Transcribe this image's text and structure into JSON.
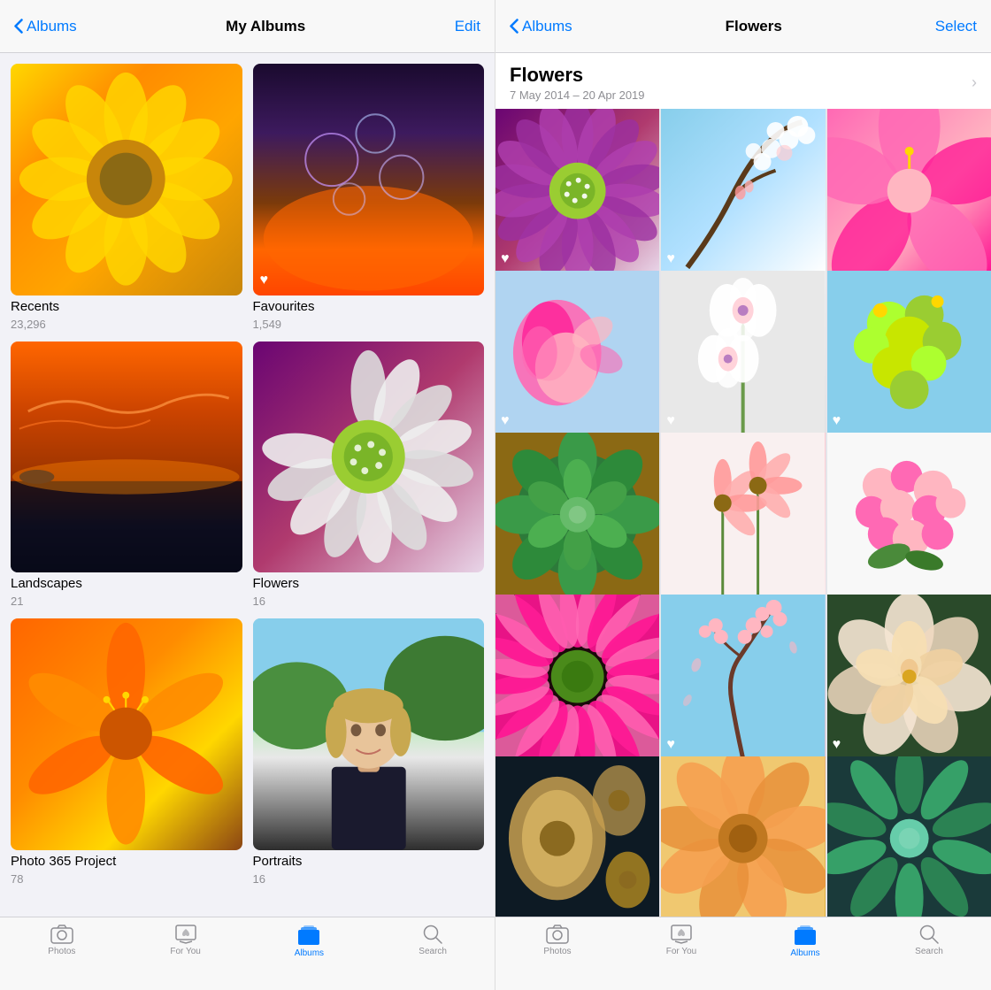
{
  "left": {
    "nav": {
      "back_label": "Albums",
      "title": "My Albums",
      "action_label": "Edit"
    },
    "albums": [
      {
        "id": "recents",
        "name": "Recents",
        "count": "23,296",
        "has_heart": false,
        "color": "recents"
      },
      {
        "id": "favourites",
        "name": "Favourites",
        "count": "1,549",
        "has_heart": true,
        "color": "favourites"
      },
      {
        "id": "landscapes",
        "name": "Landscapes",
        "count": "21",
        "has_heart": false,
        "color": "landscapes"
      },
      {
        "id": "flowers",
        "name": "Flowers",
        "count": "16",
        "has_heart": false,
        "color": "flowers"
      },
      {
        "id": "photo365",
        "name": "Photo 365 Project",
        "count": "78",
        "has_heart": false,
        "color": "photo365"
      },
      {
        "id": "portraits",
        "name": "Portraits",
        "count": "16",
        "has_heart": false,
        "color": "portraits"
      }
    ],
    "tab_bar": {
      "items": [
        {
          "id": "photos",
          "label": "Photos",
          "icon": "📷",
          "active": false
        },
        {
          "id": "for-you",
          "label": "For You",
          "icon": "❤️",
          "active": false
        },
        {
          "id": "albums",
          "label": "Albums",
          "icon": "🗂",
          "active": true
        },
        {
          "id": "search",
          "label": "Search",
          "icon": "🔍",
          "active": false
        }
      ]
    }
  },
  "right": {
    "nav": {
      "back_label": "Albums",
      "title": "Flowers",
      "action_label": "Select"
    },
    "header": {
      "title": "Flowers",
      "date_range": "7 May 2014 – 20 Apr 2019"
    },
    "photos": [
      {
        "id": "p1",
        "color_class": "photo-purple-flower",
        "has_heart": true
      },
      {
        "id": "p2",
        "color_class": "photo-white-blossom",
        "has_heart": true
      },
      {
        "id": "p3",
        "color_class": "photo-pink-flower",
        "has_heart": false
      },
      {
        "id": "p4",
        "color_class": "photo-pink-side",
        "has_heart": true
      },
      {
        "id": "p5",
        "color_class": "photo-white-orchid",
        "has_heart": true
      },
      {
        "id": "p6",
        "color_class": "photo-yellow-green",
        "has_heart": true
      },
      {
        "id": "p7",
        "color_class": "photo-succulent",
        "has_heart": false
      },
      {
        "id": "p8",
        "color_class": "photo-pink-daisy",
        "has_heart": false
      },
      {
        "id": "p9",
        "color_class": "photo-pink-cluster",
        "has_heart": false
      },
      {
        "id": "p10",
        "color_class": "photo-pink-gerbera",
        "has_heart": false
      },
      {
        "id": "p11",
        "color_class": "photo-cherry-blossom",
        "has_heart": true
      },
      {
        "id": "p12",
        "color_class": "photo-cream-rose",
        "has_heart": true
      },
      {
        "id": "p13",
        "color_class": "photo-dark-flower",
        "has_heart": false
      },
      {
        "id": "p14",
        "color_class": "photo-peach-flower",
        "has_heart": false
      },
      {
        "id": "p15",
        "color_class": "photo-teal-leaves",
        "has_heart": false
      }
    ],
    "tab_bar": {
      "items": [
        {
          "id": "photos",
          "label": "Photos",
          "icon": "📷",
          "active": false
        },
        {
          "id": "for-you",
          "label": "For You",
          "icon": "❤️",
          "active": false
        },
        {
          "id": "albums",
          "label": "Albums",
          "icon": "🗂",
          "active": true
        },
        {
          "id": "search",
          "label": "Search",
          "icon": "🔍",
          "active": false
        }
      ]
    }
  }
}
